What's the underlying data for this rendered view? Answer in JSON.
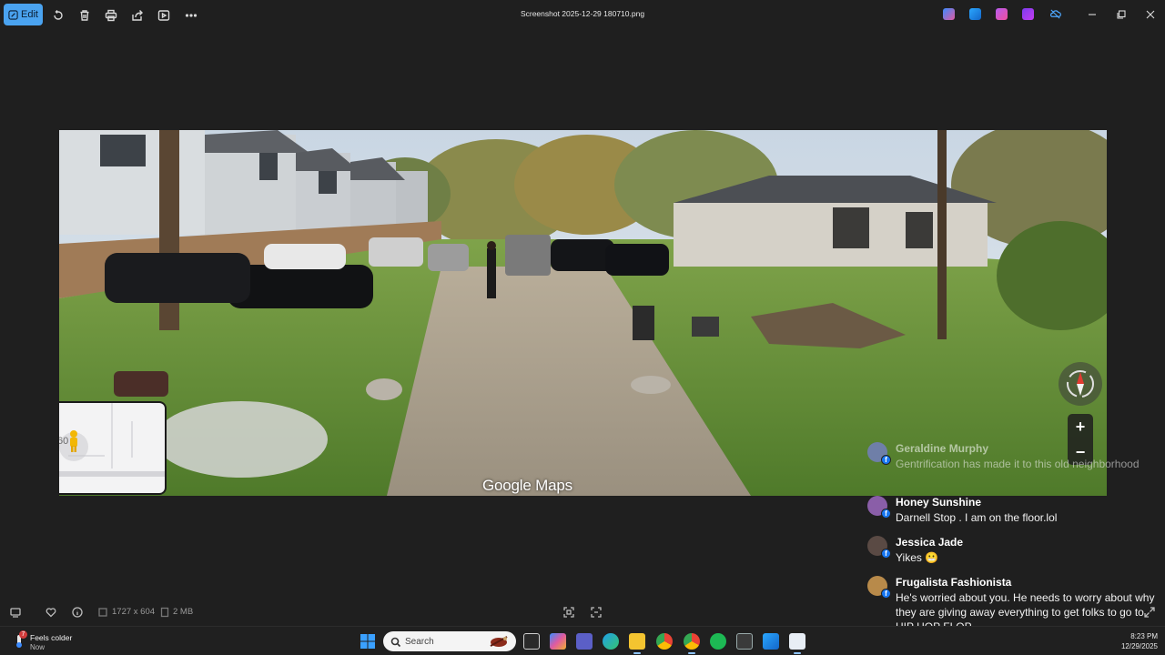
{
  "toolbar": {
    "edit_label": "Edit",
    "icons": [
      "rotate-icon",
      "delete-icon",
      "print-icon",
      "share-icon",
      "slideshow-icon",
      "more-icon"
    ],
    "title": "Screenshot 2025-12-29 180710.png"
  },
  "photo": {
    "watermark": "Google Maps",
    "minimap_label": "60",
    "zoom_in": "+",
    "zoom_out": "−"
  },
  "comments": [
    {
      "name": "Geraldine Murphy",
      "text": "Gentrification has made it to this old neighborhood",
      "avatar_color": "#6f7fa8"
    },
    {
      "name": "Honey Sunshine",
      "text": "Darnell Stop . I am on the floor.lol",
      "avatar_color": "#8a5ea8"
    },
    {
      "name": "Jessica Jade",
      "text": "Yikes 😬",
      "avatar_color": "#5a4a44"
    },
    {
      "name": "Frugalista Fashionista",
      "text": "He's worried about you. He needs to worry about why they are giving away everything to get folks to go to HIP HOP FLOP",
      "avatar_color": "#b88a4a"
    }
  ],
  "infobar": {
    "dimensions": "1727 x 604",
    "filesize": "2 MB"
  },
  "taskbar": {
    "weather_badge": "7",
    "weather_line1": "Feels colder",
    "weather_line2": "Now",
    "search_placeholder": "Search",
    "time": "8:23 PM",
    "date": "12/29/2025"
  },
  "colors": {
    "accent": "#4aa3f0",
    "background": "#1f1f1f",
    "facebook": "#1877f2"
  }
}
